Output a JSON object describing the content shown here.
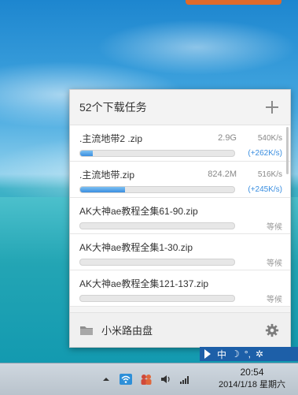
{
  "panel": {
    "title": "52个下载任务",
    "footer_label": "小米路由盘"
  },
  "downloads": [
    {
      "name": ".主流地带2 .zip",
      "size": "2.9G",
      "speed": "540K/s",
      "sub": "(+262K/s)",
      "progress": 0.08,
      "sub_style": "blue"
    },
    {
      "name": ".主流地带.zip",
      "size": "824.2M",
      "speed": "516K/s",
      "sub": "(+245K/s)",
      "progress": 0.29,
      "sub_style": "blue"
    },
    {
      "name": "AK大神ae教程全集61-90.zip",
      "size": "",
      "speed": "",
      "sub": "等候",
      "progress": 0,
      "sub_style": "grey"
    },
    {
      "name": "AK大神ae教程全集1-30.zip",
      "size": "",
      "speed": "",
      "sub": "等候",
      "progress": 0,
      "sub_style": "grey"
    },
    {
      "name": "AK大神ae教程全集121-137.zip",
      "size": "",
      "speed": "",
      "sub": "等候",
      "progress": 0,
      "sub_style": "grey"
    }
  ],
  "ime": {
    "lang": "中",
    "moon": "☽",
    "punct": "°,",
    "settings": "✲"
  },
  "clock": {
    "time": "20:54",
    "date": "2014/1/18 星期六"
  },
  "colors": {
    "accent": "#3a8ee0",
    "taskbar": "#c3ccd4",
    "ime": "#1d5fa8"
  }
}
